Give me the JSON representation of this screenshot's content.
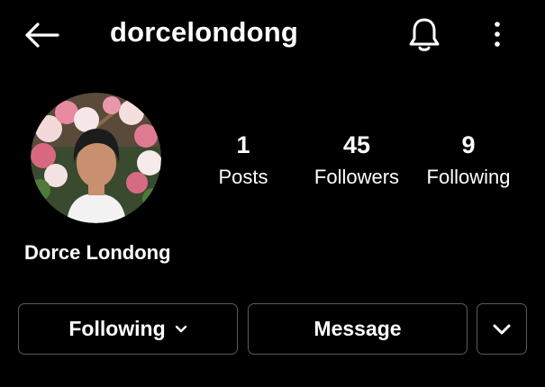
{
  "header": {
    "username": "dorcelondong",
    "back_icon": "arrow-left-icon",
    "notification_icon": "bell-icon",
    "more_icon": "more-vertical-icon"
  },
  "profile": {
    "display_name": "Dorce Londong",
    "avatar_icon": "profile-photo"
  },
  "stats": [
    {
      "value": "1",
      "label": "Posts"
    },
    {
      "value": "45",
      "label": "Followers"
    },
    {
      "value": "9",
      "label": "Following"
    }
  ],
  "actions": {
    "following_label": "Following",
    "message_label": "Message",
    "suggestions_icon": "chevron-down-icon"
  },
  "colors": {
    "background": "#000000",
    "text": "#ffffff",
    "button_border": "#5a5a5a"
  }
}
